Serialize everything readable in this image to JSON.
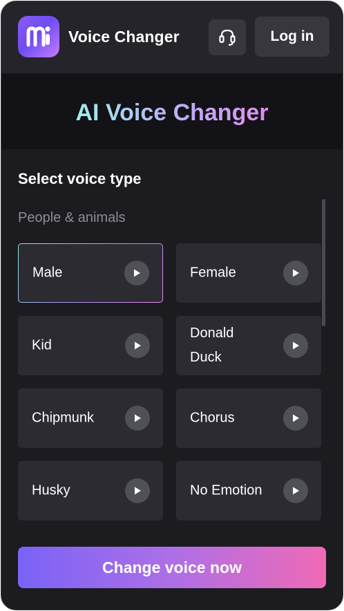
{
  "header": {
    "app_title": "Voice Changer",
    "login_label": "Log in",
    "logo_icon": "voice-changer-logo-icon",
    "support_icon": "headset-icon"
  },
  "hero": {
    "title": "AI Voice Changer"
  },
  "voice_select": {
    "title": "Select voice type",
    "category": "People & animals",
    "selected": "Male",
    "voices": [
      {
        "label": "Male",
        "selected": true
      },
      {
        "label": "Female",
        "selected": false
      },
      {
        "label": "Kid",
        "selected": false
      },
      {
        "label": "Donald Duck",
        "selected": false
      },
      {
        "label": "Chipmunk",
        "selected": false
      },
      {
        "label": "Chorus",
        "selected": false
      },
      {
        "label": "Husky",
        "selected": false
      },
      {
        "label": "No Emotion",
        "selected": false
      }
    ],
    "play_icon": "play-icon"
  },
  "cta": {
    "label": "Change voice now"
  },
  "colors": {
    "background": "#1c1b20",
    "card": "#2c2b31",
    "accent_start": "#7a63f7",
    "accent_end": "#f06ab5"
  }
}
